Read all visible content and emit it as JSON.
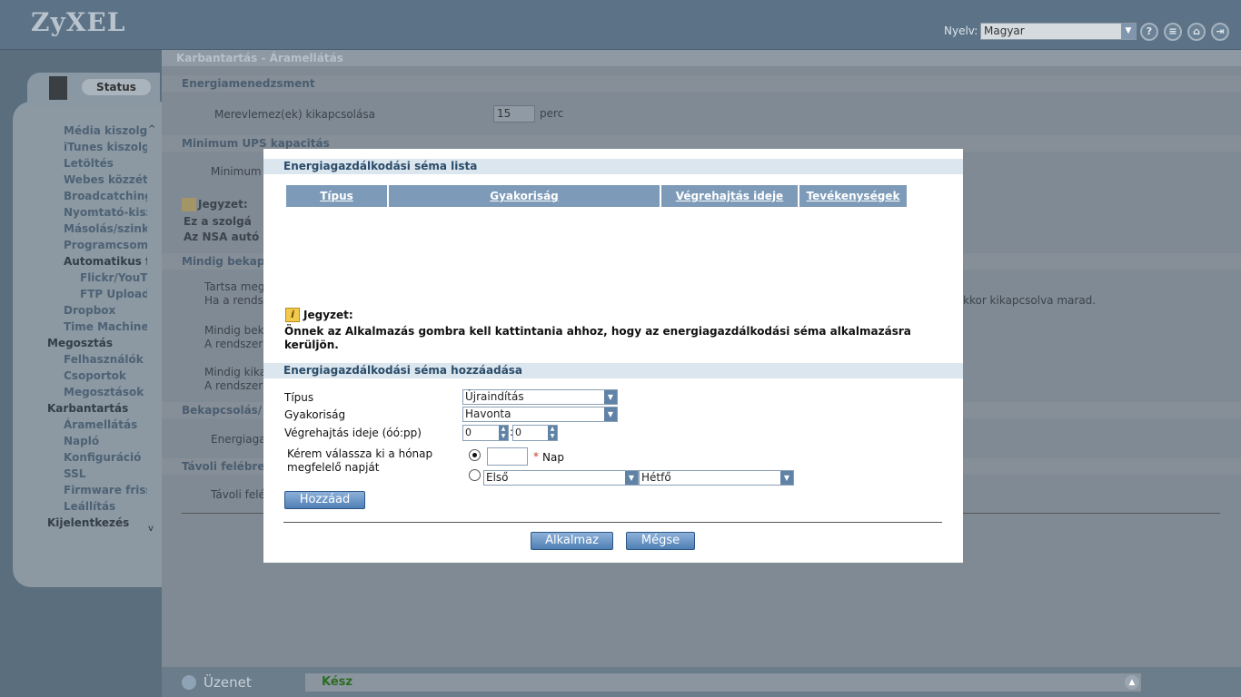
{
  "brand": {
    "logo": "ZyXEL"
  },
  "header": {
    "lang_label": "Nyelv:",
    "lang_value": "Magyar",
    "icons": [
      "help-icon",
      "doc-icon",
      "home-icon",
      "logout-icon"
    ]
  },
  "sidebar": {
    "tab_label": "Status",
    "items": [
      {
        "label": "Média kiszolgá",
        "level": 2
      },
      {
        "label": "iTunes kiszolg",
        "level": 2
      },
      {
        "label": "Letöltés",
        "level": 2
      },
      {
        "label": "Webes közzét",
        "level": 2
      },
      {
        "label": "Broadcatching",
        "level": 2
      },
      {
        "label": "Nyomtató-kisz",
        "level": 2
      },
      {
        "label": "Másolás/szink",
        "level": 2
      },
      {
        "label": "Programcsom",
        "level": 2
      },
      {
        "label": "Automatikus f",
        "level": 2
      },
      {
        "label": "Flickr/YouT",
        "level": 3
      },
      {
        "label": "FTP Upload",
        "level": 3
      },
      {
        "label": "Dropbox",
        "level": 2
      },
      {
        "label": "Time Machine",
        "level": 2
      },
      {
        "label": "Megosztás",
        "level": 1
      },
      {
        "label": "Felhasználók",
        "level": 2
      },
      {
        "label": "Csoportok",
        "level": 2
      },
      {
        "label": "Megosztások",
        "level": 2
      },
      {
        "label": "Karbantartás",
        "level": 1
      },
      {
        "label": "Áramellátás",
        "level": 2
      },
      {
        "label": "Napló",
        "level": 2
      },
      {
        "label": "Konfiguráció",
        "level": 2
      },
      {
        "label": "SSL",
        "level": 2
      },
      {
        "label": "Firmware friss",
        "level": 2
      },
      {
        "label": "Leállítás",
        "level": 2
      },
      {
        "label": "Kijelentkezés",
        "level": 1
      }
    ]
  },
  "main": {
    "breadcrumb": "Karbantartás - Áramellátás",
    "sec_energy": "Energiamenedzsment",
    "hdd_label": "Merevlemez(ek) kikapcsolása",
    "hdd_value": "15",
    "hdd_unit": "perc",
    "sec_ups": "Minimum UPS kapacitás",
    "ups_label": "Minimum U",
    "note_label": "Jegyzet:",
    "note1": "Ez a szolgá",
    "note2": "Az NSA autó",
    "sec_always": "Mindig bekapc",
    "opt1": "Tartsa meg",
    "opt1b": "Ha a rendsz",
    "opt1_tail": "kkor kikapcsolva marad.",
    "opt2": "Mindig beka",
    "opt2b": "A rendszer",
    "opt3": "Mindig kika",
    "opt3b": "A rendszer",
    "sec_onoff": "Bekapcsolás/",
    "chk1": "Energiaga",
    "sec_remote": "Távoli felébre",
    "chk2": "Távoli felé"
  },
  "bottom": {
    "label": "Üzenet",
    "status": "Kész"
  },
  "dialog": {
    "list_title": "Energiagazdálkodási séma lista",
    "columns": [
      "Típus",
      "Gyakoriság",
      "Végrehajtás ideje",
      "Tevékenységek"
    ],
    "note_label": "Jegyzet:",
    "note_text": "Önnek az Alkalmazás gombra kell kattintania ahhoz, hogy az energiagazdálkodási séma alkalmazásra kerüljön.",
    "add_title": "Energiagazdálkodási séma hozzáadása",
    "type_label": "Típus",
    "type_value": "Újraindítás",
    "freq_label": "Gyakoriság",
    "freq_value": "Havonta",
    "time_label": "Végrehajtás ideje (óó:pp)",
    "hour": "0",
    "minute": "0",
    "day_prompt_1": "Kérem válassza ki a hónap",
    "day_prompt_2": "megfelelő napját",
    "day_value": "",
    "required_mark": "*",
    "day_unit": "Nap",
    "ordinal_value": "Első",
    "weekday_value": "Hétfő",
    "add_button": "Hozzáad",
    "apply_button": "Alkalmaz",
    "cancel_button": "Mégse"
  }
}
